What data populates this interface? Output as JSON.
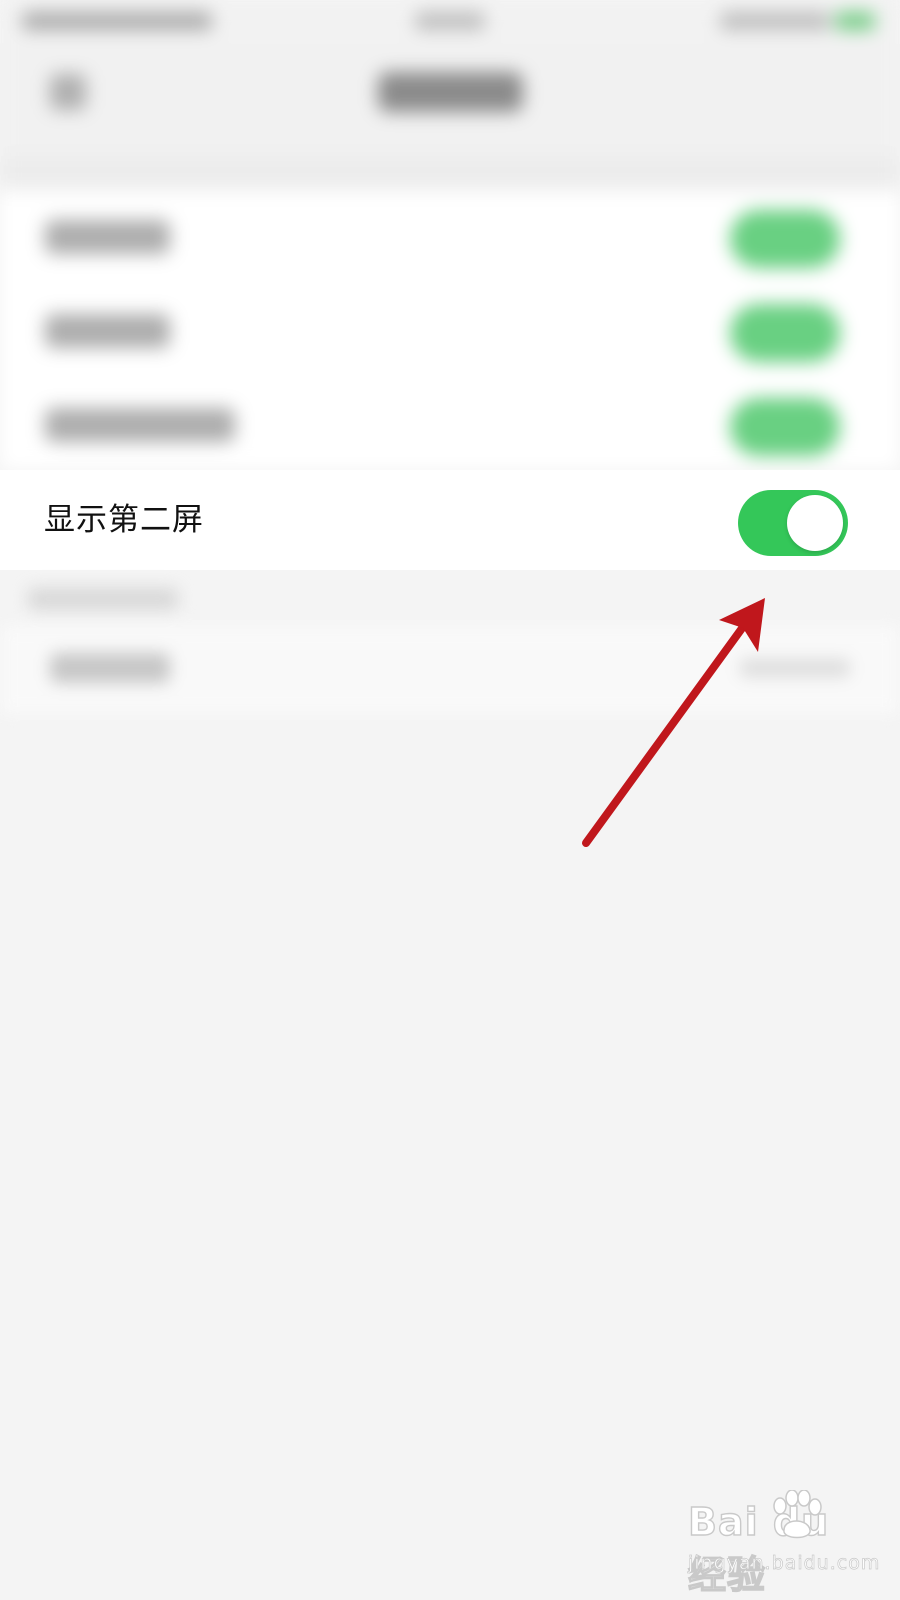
{
  "setting": {
    "label": "显示第二屏",
    "toggle_state": "on"
  },
  "colors": {
    "toggle_on": "#34c759",
    "arrow": "#c0171c",
    "background": "#f4f4f4"
  },
  "annotation": {
    "arrow_target": "toggle"
  },
  "watermark": {
    "logo": "Bai du 经验",
    "url": "jingyan.baidu.com"
  }
}
